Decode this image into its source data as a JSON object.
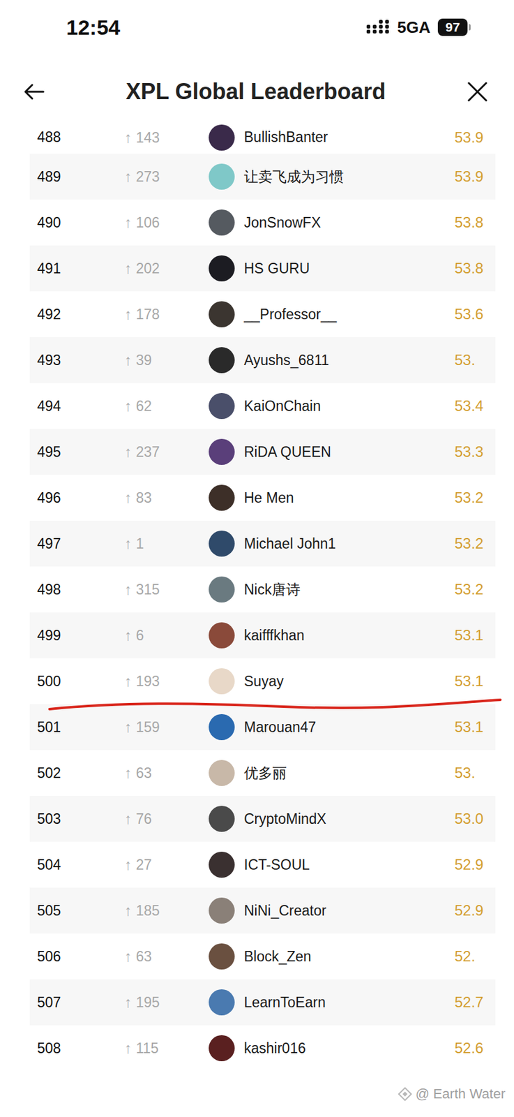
{
  "status_bar": {
    "time": "12:54",
    "network": "5GA",
    "battery": "97"
  },
  "header": {
    "title": "XPL Global Leaderboard"
  },
  "rows": [
    {
      "rank": "488",
      "arrow": "↑",
      "change": "143",
      "name": "BullishBanter",
      "score": "53.9",
      "cutoff": false,
      "partial": true
    },
    {
      "rank": "489",
      "arrow": "↑",
      "change": "273",
      "name": "让卖飞成为习惯",
      "score": "53.9",
      "cutoff": false,
      "partial": false
    },
    {
      "rank": "490",
      "arrow": "↑",
      "change": "106",
      "name": "JonSnowFX",
      "score": "53.8",
      "cutoff": false,
      "partial": false
    },
    {
      "rank": "491",
      "arrow": "↑",
      "change": "202",
      "name": "HS GURU",
      "score": "53.8",
      "cutoff": false,
      "partial": false
    },
    {
      "rank": "492",
      "arrow": "↑",
      "change": "178",
      "name": "__Professor__",
      "score": "53.6",
      "cutoff": false,
      "partial": false
    },
    {
      "rank": "493",
      "arrow": "↑",
      "change": "39",
      "name": "Ayushs_6811",
      "score": "53.",
      "cutoff": false,
      "partial": false
    },
    {
      "rank": "494",
      "arrow": "↑",
      "change": "62",
      "name": "KaiOnChain",
      "score": "53.4",
      "cutoff": false,
      "partial": false
    },
    {
      "rank": "495",
      "arrow": "↑",
      "change": "237",
      "name": "RiDA QUEEN",
      "score": "53.3",
      "cutoff": false,
      "partial": false
    },
    {
      "rank": "496",
      "arrow": "↑",
      "change": "83",
      "name": "He Men",
      "score": "53.2",
      "cutoff": false,
      "partial": false
    },
    {
      "rank": "497",
      "arrow": "↑",
      "change": "1",
      "name": "Michael John1",
      "score": "53.2",
      "cutoff": false,
      "partial": false
    },
    {
      "rank": "498",
      "arrow": "↑",
      "change": "315",
      "name": "Nick唐诗",
      "score": "53.2",
      "cutoff": false,
      "partial": false
    },
    {
      "rank": "499",
      "arrow": "↑",
      "change": "6",
      "name": "kaifffkhan",
      "score": "53.1",
      "cutoff": false,
      "partial": false
    },
    {
      "rank": "500",
      "arrow": "↑",
      "change": "193",
      "name": "Suyay",
      "score": "53.1",
      "cutoff": true,
      "partial": false
    },
    {
      "rank": "501",
      "arrow": "↑",
      "change": "159",
      "name": "Marouan47",
      "score": "53.1",
      "cutoff": false,
      "partial": false
    },
    {
      "rank": "502",
      "arrow": "↑",
      "change": "63",
      "name": "优多丽",
      "score": "53.",
      "cutoff": false,
      "partial": false
    },
    {
      "rank": "503",
      "arrow": "↑",
      "change": "76",
      "name": "CryptoMindX",
      "score": "53.0",
      "cutoff": false,
      "partial": false
    },
    {
      "rank": "504",
      "arrow": "↑",
      "change": "27",
      "name": "ICT-SOUL",
      "score": "52.9",
      "cutoff": false,
      "partial": false
    },
    {
      "rank": "505",
      "arrow": "↑",
      "change": "185",
      "name": "NiNi_Creator",
      "score": "52.9",
      "cutoff": false,
      "partial": false
    },
    {
      "rank": "506",
      "arrow": "↑",
      "change": "63",
      "name": "Block_Zen",
      "score": "52.",
      "cutoff": false,
      "partial": false
    },
    {
      "rank": "507",
      "arrow": "↑",
      "change": "195",
      "name": "LearnToEarn",
      "score": "52.7",
      "cutoff": false,
      "partial": false
    },
    {
      "rank": "508",
      "arrow": "↑",
      "change": "115",
      "name": "kashir016",
      "score": "52.6",
      "cutoff": false,
      "partial": false
    }
  ],
  "watermark": {
    "text": "@ Earth Water"
  }
}
